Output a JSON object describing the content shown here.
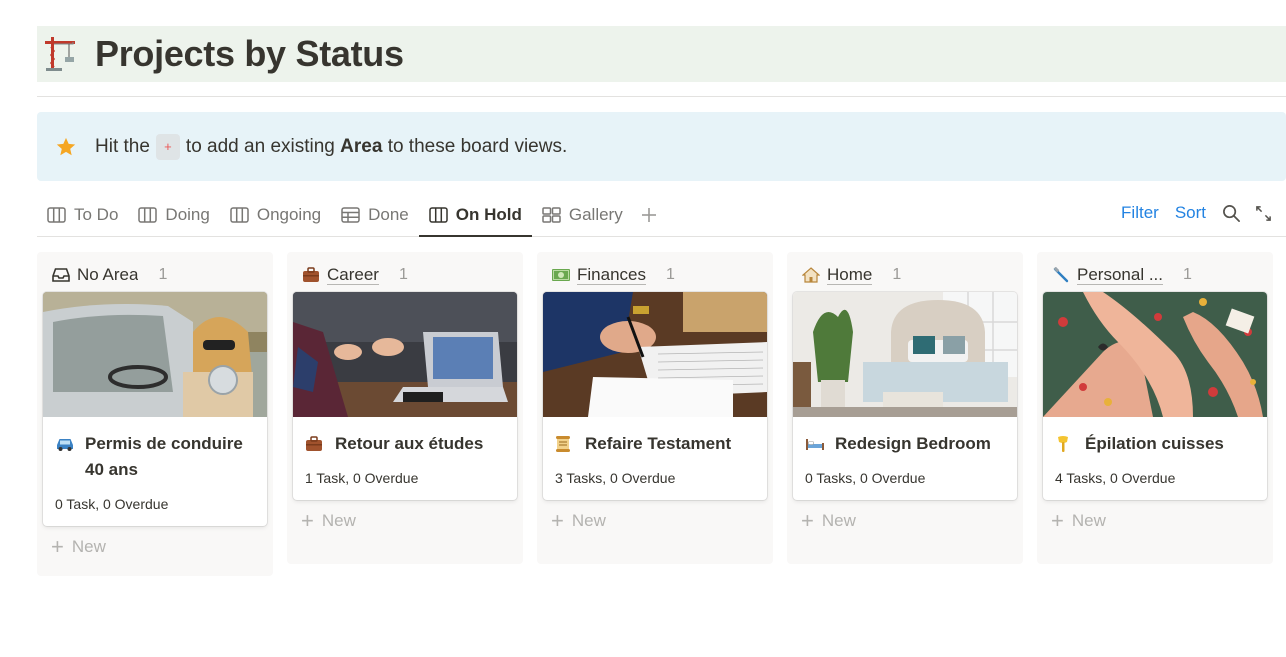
{
  "page": {
    "title": "Projects by Status",
    "title_icon": "crane-icon",
    "header_bg": "#edf3ec"
  },
  "callout": {
    "icon": "star-icon",
    "pre": "Hit the",
    "key": "+",
    "mid": "to add an existing",
    "bold": "Area",
    "post": "to these board views.",
    "bg": "#e7f3f8"
  },
  "views": {
    "tabs": [
      {
        "label": "To Do",
        "icon": "board-icon",
        "active": false
      },
      {
        "label": "Doing",
        "icon": "board-icon",
        "active": false
      },
      {
        "label": "Ongoing",
        "icon": "board-icon",
        "active": false
      },
      {
        "label": "Done",
        "icon": "table-icon",
        "active": false
      },
      {
        "label": "On Hold",
        "icon": "board-icon",
        "active": true
      },
      {
        "label": "Gallery",
        "icon": "gallery-icon",
        "active": false
      }
    ],
    "add_icon": "plus-icon",
    "filter_label": "Filter",
    "sort_label": "Sort",
    "accent": "#2383e2"
  },
  "board": {
    "new_label": "New",
    "columns": [
      {
        "name": "No Area",
        "icon": "inbox-icon",
        "count": "1",
        "card": {
          "title": "Permis de conduire 40 ans",
          "icon": "car-icon",
          "meta": "0 Task, 0 Overdue",
          "cover": "woman-in-vintage-car"
        }
      },
      {
        "name": "Career",
        "icon": "briefcase-icon",
        "count": "1",
        "card": {
          "title": "Retour aux études",
          "icon": "briefcase-icon",
          "meta": "1 Task, 0 Overdue",
          "cover": "hands-and-laptop-meeting"
        }
      },
      {
        "name": "Finances",
        "icon": "money-icon",
        "count": "1",
        "card": {
          "title": "Refaire Testament",
          "icon": "scroll-icon",
          "meta": "3 Tasks, 0 Overdue",
          "cover": "signing-document"
        }
      },
      {
        "name": "Home",
        "icon": "house-icon",
        "count": "1",
        "card": {
          "title": "Redesign Bedroom",
          "icon": "bed-icon",
          "meta": "0 Tasks, 0 Overdue",
          "cover": "bedroom-interior"
        }
      },
      {
        "name": "Personal ...",
        "icon": "razor-icon",
        "count": "1",
        "card": {
          "title": "Épilation cuisses",
          "icon": "wax-icon",
          "meta": "4 Tasks, 0 Overdue",
          "cover": "legs-in-flower-bath"
        }
      }
    ]
  }
}
